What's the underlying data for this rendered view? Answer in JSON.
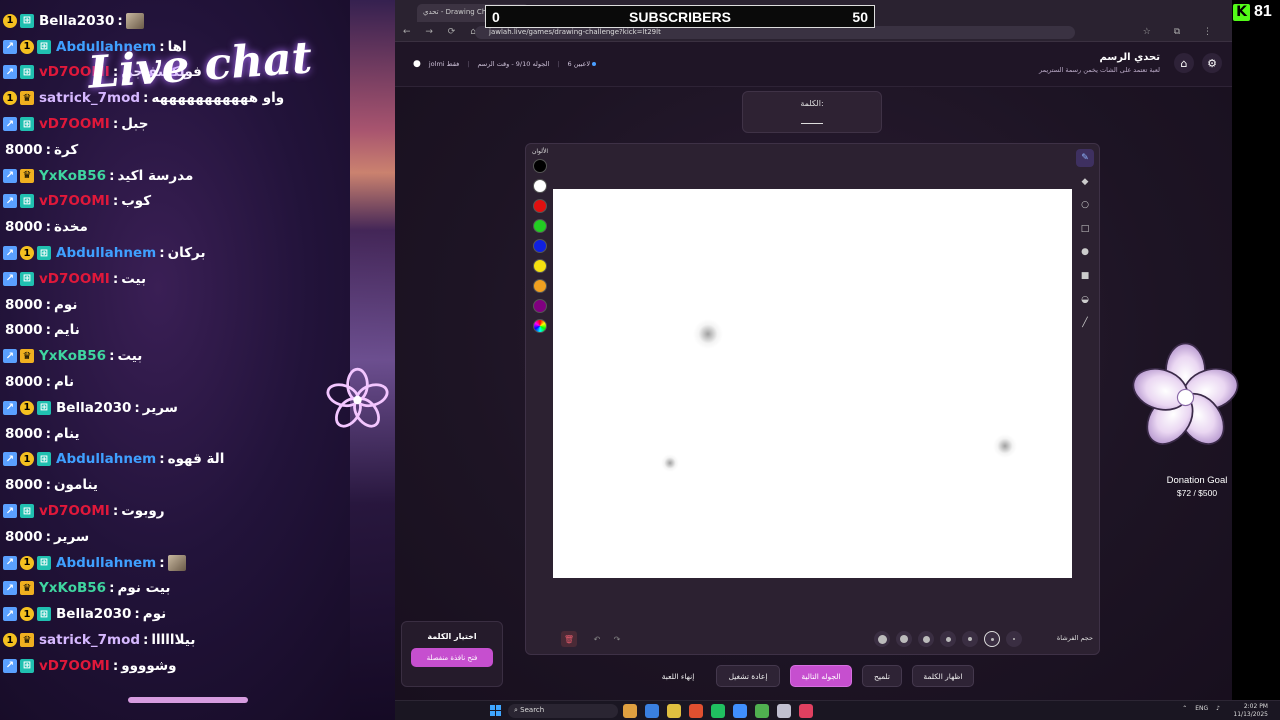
{
  "chat": {
    "title": "Live chat",
    "messages": [
      {
        "user": "Bella2030",
        "user_color": "#ffffff",
        "text": "",
        "badges": [
          "gold",
          "teal"
        ],
        "emote": true
      },
      {
        "user": "Abdullahnem",
        "user_color": "#3fa0ff",
        "text": "اها",
        "badges": [
          "blue",
          "gold",
          "teal"
        ]
      },
      {
        "user": "vD7OOMI",
        "user_color": "#e0183a",
        "text": "فولكسفاجن",
        "badges": [
          "blue",
          "teal"
        ]
      },
      {
        "user": "satrick_7mod",
        "user_color": "#d6b8ff",
        "text": "واو هههههههههههه",
        "badges": [
          "gold",
          "crown"
        ]
      },
      {
        "user": "vD7OOMI",
        "user_color": "#e0183a",
        "text": "جبل",
        "badges": [
          "blue",
          "teal"
        ]
      },
      {
        "user": "8000",
        "user_color": "#ffffff",
        "text": "كرة",
        "badges": []
      },
      {
        "user": "YxKoB56",
        "user_color": "#3fd6a0",
        "text": "مدرسة اكيد",
        "badges": [
          "blue",
          "crown"
        ]
      },
      {
        "user": "vD7OOMI",
        "user_color": "#e0183a",
        "text": "كوب",
        "badges": [
          "blue",
          "teal"
        ]
      },
      {
        "user": "8000",
        "user_color": "#ffffff",
        "text": "مخدة",
        "badges": []
      },
      {
        "user": "Abdullahnem",
        "user_color": "#3fa0ff",
        "text": "بركان",
        "badges": [
          "blue",
          "gold",
          "teal"
        ]
      },
      {
        "user": "vD7OOMI",
        "user_color": "#e0183a",
        "text": "بيت",
        "badges": [
          "blue",
          "teal"
        ]
      },
      {
        "user": "8000",
        "user_color": "#ffffff",
        "text": "نوم",
        "badges": []
      },
      {
        "user": "8000",
        "user_color": "#ffffff",
        "text": "نايم",
        "badges": []
      },
      {
        "user": "YxKoB56",
        "user_color": "#3fd6a0",
        "text": "بيت",
        "badges": [
          "blue",
          "crown"
        ]
      },
      {
        "user": "8000",
        "user_color": "#ffffff",
        "text": "نام",
        "badges": []
      },
      {
        "user": "Bella2030",
        "user_color": "#ffffff",
        "text": "سرير",
        "badges": [
          "blue",
          "gold",
          "teal"
        ]
      },
      {
        "user": "8000",
        "user_color": "#ffffff",
        "text": "ينام",
        "badges": []
      },
      {
        "user": "Abdullahnem",
        "user_color": "#3fa0ff",
        "text": "الة قهوه",
        "badges": [
          "blue",
          "gold",
          "teal"
        ]
      },
      {
        "user": "8000",
        "user_color": "#ffffff",
        "text": "ينامون",
        "badges": []
      },
      {
        "user": "vD7OOMI",
        "user_color": "#e0183a",
        "text": "روبوت",
        "badges": [
          "blue",
          "teal"
        ]
      },
      {
        "user": "8000",
        "user_color": "#ffffff",
        "text": "سرير",
        "badges": []
      },
      {
        "user": "Abdullahnem",
        "user_color": "#3fa0ff",
        "text": "",
        "badges": [
          "blue",
          "gold",
          "teal"
        ],
        "emote": true
      },
      {
        "user": "YxKoB56",
        "user_color": "#3fd6a0",
        "text": "بيت نوم",
        "badges": [
          "blue",
          "crown"
        ]
      },
      {
        "user": "Bella2030",
        "user_color": "#ffffff",
        "text": "نوم",
        "badges": [
          "blue",
          "gold",
          "teal"
        ]
      },
      {
        "user": "satrick_7mod",
        "user_color": "#d6b8ff",
        "text": "بيلاااااا",
        "badges": [
          "gold",
          "crown"
        ]
      },
      {
        "user": "vD7OOMI",
        "user_color": "#e0183a",
        "text": "وشوووو",
        "badges": [
          "blue",
          "teal"
        ]
      }
    ]
  },
  "subscribers": {
    "current": "0",
    "label": "SUBSCRIBERS",
    "goal": "50"
  },
  "browser": {
    "tab_title": "تحدي - Drawing Challenge",
    "url": "jawlah.live/games/drawing-challenge?kick=lt29lt"
  },
  "app": {
    "title": "تحدي الرسم",
    "subtitle": "لعبة تعتمد على الشات يخمن رسمة الستريمر",
    "players": "6 لاعبين",
    "round": "الجوله 9/10 - وقت الرسم",
    "mode": "jolmi فقط",
    "word_label": "الكلمة:",
    "colors_label": "الألوان",
    "brush_size_label": "حجم الفرشاة",
    "colors": [
      "#000000",
      "#ffffff",
      "#e01010",
      "#22cc22",
      "#1020e0",
      "#f5e010",
      "#f0a020",
      "#800080"
    ],
    "word_picker": {
      "title": "اختيار الكلمة",
      "button": "فتح نافذة منفصلة"
    },
    "actions": {
      "end_game": "إنهاء اللعبة",
      "restart": "إعادة تشغيل",
      "next_round": "الجوله التالية",
      "hint": "تلميح",
      "show_word": "اظهار الكلمة"
    }
  },
  "kick": {
    "count": "81"
  },
  "donation": {
    "title": "Donation Goal",
    "amount": "$72 / $500"
  },
  "taskbar": {
    "search": "Search",
    "lang": "ENG",
    "time": "2:02 PM",
    "date": "11/13/2025"
  }
}
